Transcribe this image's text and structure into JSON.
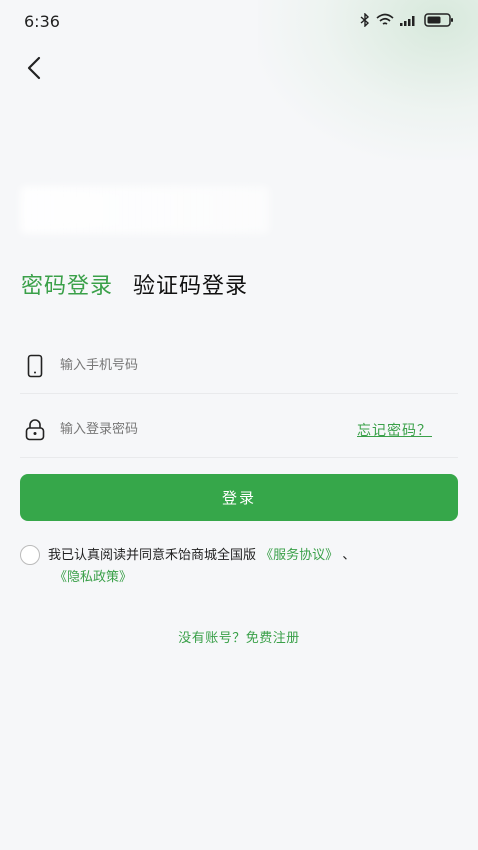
{
  "status_bar": {
    "time": "6:36",
    "icons": [
      "bluetooth-icon",
      "wifi-icon",
      "signal-icon",
      "battery-icon"
    ]
  },
  "nav": {
    "back_icon": "chevron-left-icon"
  },
  "tabs": [
    {
      "label": "密码登录",
      "active": true
    },
    {
      "label": "验证码登录",
      "active": false
    }
  ],
  "form": {
    "phone_placeholder": "输入手机号码",
    "password_placeholder": "输入登录密码",
    "forgot_label": "忘记密码？",
    "login_label": "登录"
  },
  "agreement": {
    "text": "我已认真阅读并同意禾饴商城全国版",
    "service_link": "《服务协议》",
    "separator": "、",
    "privacy_link": "《隐私政策》",
    "checked": false
  },
  "register": {
    "label": "没有账号？免费注册"
  },
  "colors": {
    "accent": "#36a74a",
    "accent_text": "#3aa049",
    "background": "#f6f7f9"
  }
}
